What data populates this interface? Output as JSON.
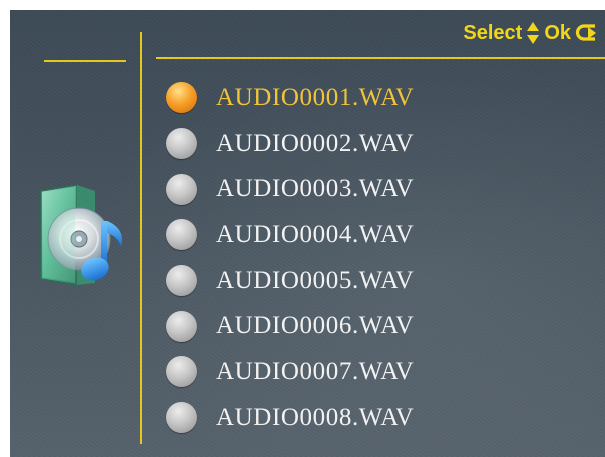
{
  "hint_bar": {
    "select_label": "Select",
    "ok_label": "Ok",
    "icons": [
      "up-down-arrows-icon",
      "return-arrow-icon"
    ],
    "color": "#f2d61a"
  },
  "category_icon": "music-cd-icon",
  "accent_color": "#e6c81d",
  "files": [
    {
      "name": "AUDIO0001.WAV",
      "selected": true
    },
    {
      "name": "AUDIO0002.WAV",
      "selected": false
    },
    {
      "name": "AUDIO0003.WAV",
      "selected": false
    },
    {
      "name": "AUDIO0004.WAV",
      "selected": false
    },
    {
      "name": "AUDIO0005.WAV",
      "selected": false
    },
    {
      "name": "AUDIO0006.WAV",
      "selected": false
    },
    {
      "name": "AUDIO0007.WAV",
      "selected": false
    },
    {
      "name": "AUDIO0008.WAV",
      "selected": false
    }
  ],
  "selected_color": "#f2c43a",
  "text_color": "#f2f2f2"
}
